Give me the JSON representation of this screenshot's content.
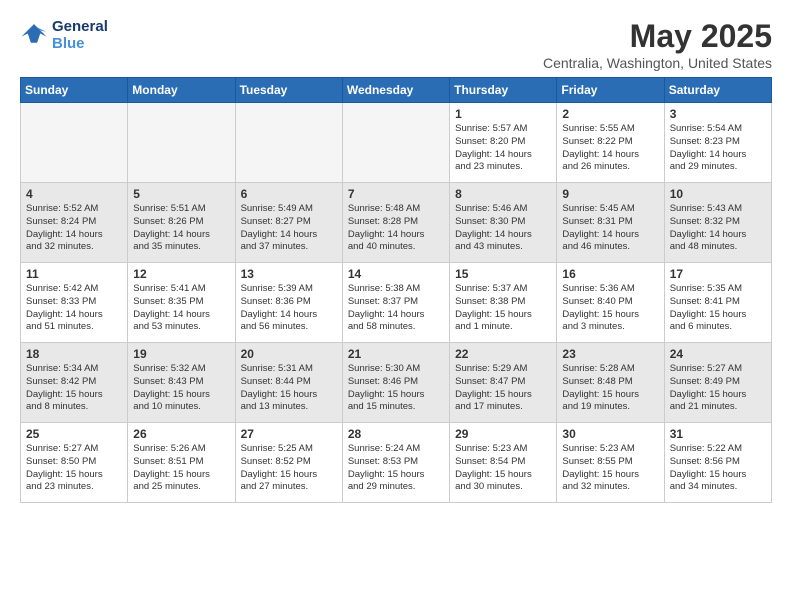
{
  "header": {
    "logo_line1": "General",
    "logo_line2": "Blue",
    "month": "May 2025",
    "location": "Centralia, Washington, United States"
  },
  "days_of_week": [
    "Sunday",
    "Monday",
    "Tuesday",
    "Wednesday",
    "Thursday",
    "Friday",
    "Saturday"
  ],
  "weeks": [
    [
      {
        "day": "",
        "info": "",
        "empty": true
      },
      {
        "day": "",
        "info": "",
        "empty": true
      },
      {
        "day": "",
        "info": "",
        "empty": true
      },
      {
        "day": "",
        "info": "",
        "empty": true
      },
      {
        "day": "1",
        "info": "Sunrise: 5:57 AM\nSunset: 8:20 PM\nDaylight: 14 hours\nand 23 minutes.",
        "empty": false
      },
      {
        "day": "2",
        "info": "Sunrise: 5:55 AM\nSunset: 8:22 PM\nDaylight: 14 hours\nand 26 minutes.",
        "empty": false
      },
      {
        "day": "3",
        "info": "Sunrise: 5:54 AM\nSunset: 8:23 PM\nDaylight: 14 hours\nand 29 minutes.",
        "empty": false
      }
    ],
    [
      {
        "day": "4",
        "info": "Sunrise: 5:52 AM\nSunset: 8:24 PM\nDaylight: 14 hours\nand 32 minutes.",
        "empty": false
      },
      {
        "day": "5",
        "info": "Sunrise: 5:51 AM\nSunset: 8:26 PM\nDaylight: 14 hours\nand 35 minutes.",
        "empty": false
      },
      {
        "day": "6",
        "info": "Sunrise: 5:49 AM\nSunset: 8:27 PM\nDaylight: 14 hours\nand 37 minutes.",
        "empty": false
      },
      {
        "day": "7",
        "info": "Sunrise: 5:48 AM\nSunset: 8:28 PM\nDaylight: 14 hours\nand 40 minutes.",
        "empty": false
      },
      {
        "day": "8",
        "info": "Sunrise: 5:46 AM\nSunset: 8:30 PM\nDaylight: 14 hours\nand 43 minutes.",
        "empty": false
      },
      {
        "day": "9",
        "info": "Sunrise: 5:45 AM\nSunset: 8:31 PM\nDaylight: 14 hours\nand 46 minutes.",
        "empty": false
      },
      {
        "day": "10",
        "info": "Sunrise: 5:43 AM\nSunset: 8:32 PM\nDaylight: 14 hours\nand 48 minutes.",
        "empty": false
      }
    ],
    [
      {
        "day": "11",
        "info": "Sunrise: 5:42 AM\nSunset: 8:33 PM\nDaylight: 14 hours\nand 51 minutes.",
        "empty": false
      },
      {
        "day": "12",
        "info": "Sunrise: 5:41 AM\nSunset: 8:35 PM\nDaylight: 14 hours\nand 53 minutes.",
        "empty": false
      },
      {
        "day": "13",
        "info": "Sunrise: 5:39 AM\nSunset: 8:36 PM\nDaylight: 14 hours\nand 56 minutes.",
        "empty": false
      },
      {
        "day": "14",
        "info": "Sunrise: 5:38 AM\nSunset: 8:37 PM\nDaylight: 14 hours\nand 58 minutes.",
        "empty": false
      },
      {
        "day": "15",
        "info": "Sunrise: 5:37 AM\nSunset: 8:38 PM\nDaylight: 15 hours\nand 1 minute.",
        "empty": false
      },
      {
        "day": "16",
        "info": "Sunrise: 5:36 AM\nSunset: 8:40 PM\nDaylight: 15 hours\nand 3 minutes.",
        "empty": false
      },
      {
        "day": "17",
        "info": "Sunrise: 5:35 AM\nSunset: 8:41 PM\nDaylight: 15 hours\nand 6 minutes.",
        "empty": false
      }
    ],
    [
      {
        "day": "18",
        "info": "Sunrise: 5:34 AM\nSunset: 8:42 PM\nDaylight: 15 hours\nand 8 minutes.",
        "empty": false
      },
      {
        "day": "19",
        "info": "Sunrise: 5:32 AM\nSunset: 8:43 PM\nDaylight: 15 hours\nand 10 minutes.",
        "empty": false
      },
      {
        "day": "20",
        "info": "Sunrise: 5:31 AM\nSunset: 8:44 PM\nDaylight: 15 hours\nand 13 minutes.",
        "empty": false
      },
      {
        "day": "21",
        "info": "Sunrise: 5:30 AM\nSunset: 8:46 PM\nDaylight: 15 hours\nand 15 minutes.",
        "empty": false
      },
      {
        "day": "22",
        "info": "Sunrise: 5:29 AM\nSunset: 8:47 PM\nDaylight: 15 hours\nand 17 minutes.",
        "empty": false
      },
      {
        "day": "23",
        "info": "Sunrise: 5:28 AM\nSunset: 8:48 PM\nDaylight: 15 hours\nand 19 minutes.",
        "empty": false
      },
      {
        "day": "24",
        "info": "Sunrise: 5:27 AM\nSunset: 8:49 PM\nDaylight: 15 hours\nand 21 minutes.",
        "empty": false
      }
    ],
    [
      {
        "day": "25",
        "info": "Sunrise: 5:27 AM\nSunset: 8:50 PM\nDaylight: 15 hours\nand 23 minutes.",
        "empty": false
      },
      {
        "day": "26",
        "info": "Sunrise: 5:26 AM\nSunset: 8:51 PM\nDaylight: 15 hours\nand 25 minutes.",
        "empty": false
      },
      {
        "day": "27",
        "info": "Sunrise: 5:25 AM\nSunset: 8:52 PM\nDaylight: 15 hours\nand 27 minutes.",
        "empty": false
      },
      {
        "day": "28",
        "info": "Sunrise: 5:24 AM\nSunset: 8:53 PM\nDaylight: 15 hours\nand 29 minutes.",
        "empty": false
      },
      {
        "day": "29",
        "info": "Sunrise: 5:23 AM\nSunset: 8:54 PM\nDaylight: 15 hours\nand 30 minutes.",
        "empty": false
      },
      {
        "day": "30",
        "info": "Sunrise: 5:23 AM\nSunset: 8:55 PM\nDaylight: 15 hours\nand 32 minutes.",
        "empty": false
      },
      {
        "day": "31",
        "info": "Sunrise: 5:22 AM\nSunset: 8:56 PM\nDaylight: 15 hours\nand 34 minutes.",
        "empty": false
      }
    ]
  ]
}
